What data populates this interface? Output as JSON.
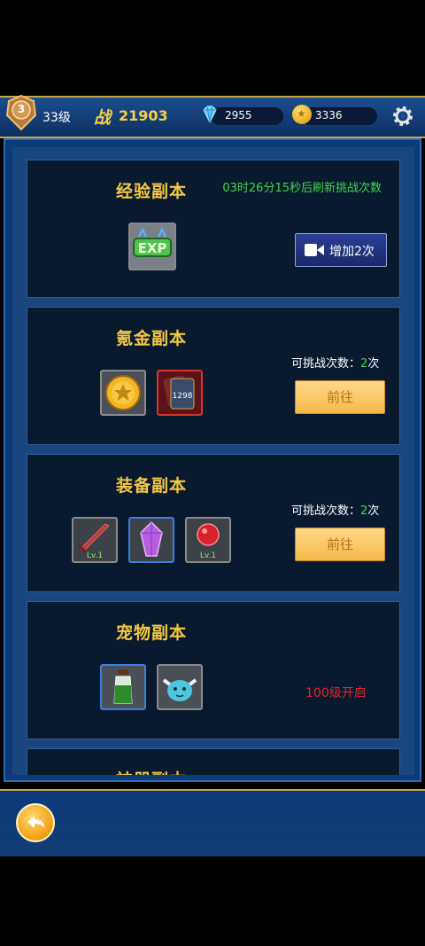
{
  "header": {
    "rank_badge": "3",
    "level": "33级",
    "power_label": "战",
    "power_value": "21903",
    "diamonds": "2955",
    "gold": "3336",
    "icons": [
      "rank-badge-icon",
      "diamond-icon",
      "gold-coin-icon",
      "gear-icon"
    ]
  },
  "cards": [
    {
      "title": "经验副本",
      "timer": "03时26分15秒后刷新挑战次数",
      "button": "增加2次",
      "items": [
        {
          "name": "exp-item",
          "label": "EXP"
        }
      ]
    },
    {
      "title": "氪金副本",
      "chance_label": "可挑战次数：",
      "chance_num": "2",
      "chance_unit": "次",
      "button": "前往",
      "items": [
        {
          "name": "gold-coin-item"
        },
        {
          "name": "card-item",
          "label": "1298"
        }
      ]
    },
    {
      "title": "装备副本",
      "chance_label": "可挑战次数：",
      "chance_num": "2",
      "chance_unit": "次",
      "button": "前往",
      "items": [
        {
          "name": "sword-item",
          "label": "Lv.1"
        },
        {
          "name": "crystal-item"
        },
        {
          "name": "red-gem-item",
          "label": "Lv.1"
        }
      ]
    },
    {
      "title": "宠物副本",
      "locked": "100级开启",
      "items": [
        {
          "name": "potion-item"
        },
        {
          "name": "pet-item"
        }
      ]
    },
    {
      "title": "神器副本"
    }
  ],
  "colors": {
    "title": "#f5c842",
    "timer": "#3fd64d",
    "locked": "#e0232b"
  }
}
